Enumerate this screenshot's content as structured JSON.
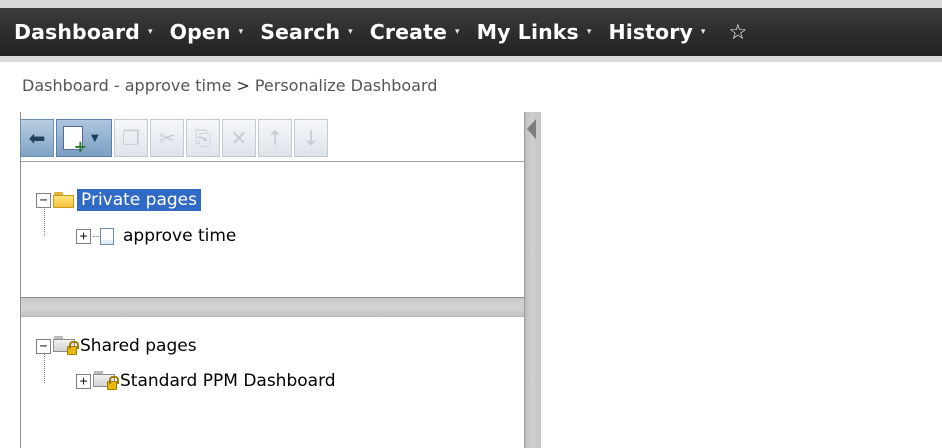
{
  "menubar": {
    "items": [
      {
        "label": "Dashboard",
        "caret": "▾"
      },
      {
        "label": "Open",
        "caret": "▾"
      },
      {
        "label": "Search",
        "caret": "▾"
      },
      {
        "label": "Create",
        "caret": "▾"
      },
      {
        "label": "My Links",
        "caret": "▾"
      },
      {
        "label": "History",
        "caret": "▾"
      }
    ],
    "favorite_icon": "☆"
  },
  "breadcrumb": {
    "parent": "Dashboard - approve time",
    "separator": ">",
    "current": "Personalize Dashboard"
  },
  "toolbar": {
    "buttons": [
      {
        "name": "back",
        "icon": "back-arrow-icon",
        "enabled": true
      },
      {
        "name": "new",
        "icon": "new-page-icon",
        "enabled": true
      },
      {
        "name": "copy",
        "icon": "copy-icon",
        "enabled": false
      },
      {
        "name": "cut",
        "icon": "cut-icon",
        "enabled": false
      },
      {
        "name": "paste",
        "icon": "paste-icon",
        "enabled": false
      },
      {
        "name": "delete",
        "icon": "delete-icon",
        "enabled": false
      },
      {
        "name": "move-up",
        "icon": "arrow-up-icon",
        "enabled": false
      },
      {
        "name": "move-down",
        "icon": "arrow-down-icon",
        "enabled": false
      }
    ],
    "glyphs": {
      "back": "⬅",
      "copy": "❐",
      "cut": "✂",
      "paste": "⎘",
      "delete": "✕",
      "up": "↑",
      "down": "↓",
      "new_plus": "+",
      "new_caret": "▼"
    }
  },
  "tree_private": {
    "root": {
      "label": "Private pages",
      "expander": "−",
      "selected": true
    },
    "children": [
      {
        "label": "approve time",
        "expander": "+"
      }
    ]
  },
  "tree_shared": {
    "root": {
      "label": "Shared pages",
      "expander": "−"
    },
    "children": [
      {
        "label": "Standard PPM Dashboard",
        "expander": "+"
      }
    ]
  },
  "colors": {
    "menubar": "#2b2b2b",
    "selection": "#316ac5",
    "toolbar_active": "#7fa3c6",
    "folder": "#f3c23c"
  }
}
